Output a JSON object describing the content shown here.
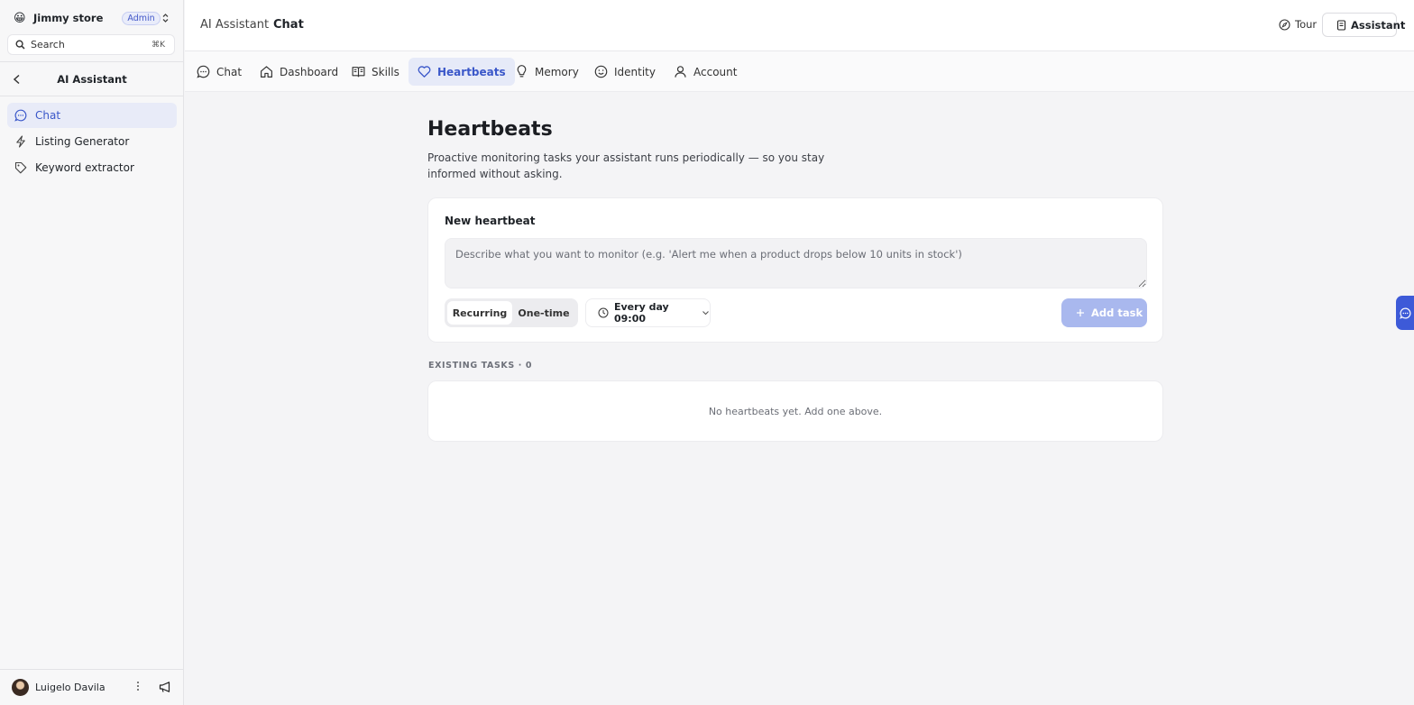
{
  "store": {
    "emoji": "😀",
    "name": "Jimmy store",
    "role_badge": "Admin"
  },
  "search": {
    "label": "Search",
    "shortcut": "⌘K"
  },
  "section": {
    "title": "AI Assistant"
  },
  "sidebar": {
    "items": [
      {
        "label": "Chat",
        "icon": "chat-bubble-icon",
        "active": true
      },
      {
        "label": "Listing Generator",
        "icon": "lightning-icon",
        "active": false
      },
      {
        "label": "Keyword extractor",
        "icon": "tag-icon",
        "active": false
      }
    ]
  },
  "user": {
    "name": "Luigelo Davila"
  },
  "header": {
    "breadcrumb_parent": "AI Assistant",
    "breadcrumb_current": "Chat",
    "tour_label": "Tour",
    "assistant_label": "Assistant"
  },
  "tabs": [
    {
      "label": "Chat",
      "icon": "chat-bubble-icon",
      "active": false
    },
    {
      "label": "Dashboard",
      "icon": "home-icon",
      "active": false
    },
    {
      "label": "Skills",
      "icon": "book-icon",
      "active": false
    },
    {
      "label": "Heartbeats",
      "icon": "heart-icon",
      "active": true
    },
    {
      "label": "Memory",
      "icon": "lightbulb-icon",
      "active": false
    },
    {
      "label": "Identity",
      "icon": "smiley-icon",
      "active": false
    },
    {
      "label": "Account",
      "icon": "user-icon",
      "active": false
    }
  ],
  "page": {
    "title": "Heartbeats",
    "description": "Proactive monitoring tasks your assistant runs periodically — so you stay informed without asking."
  },
  "new_heartbeat": {
    "title": "New heartbeat",
    "placeholder": "Describe what you want to monitor (e.g. 'Alert me when a product drops below 10 units in stock')",
    "mode_options": [
      "Recurring",
      "One-time"
    ],
    "selected_mode": "Recurring",
    "schedule": "Every day 09:00",
    "add_label": "Add task"
  },
  "existing": {
    "header": "EXISTING TASKS · 0",
    "empty_text": "No heartbeats yet. Add one above."
  },
  "colors": {
    "accent": "#3a57c9",
    "accent_soft": "#e6eaf8",
    "button_disabled": "#a9b8ee"
  }
}
